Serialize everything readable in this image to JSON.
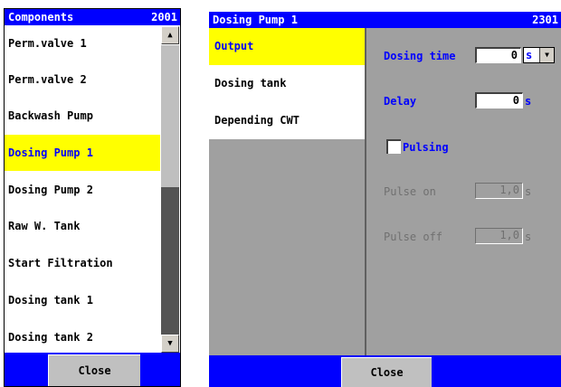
{
  "components": {
    "title": "Components",
    "code": "2001",
    "items": [
      "Perm.valve 1",
      "Perm.valve 2",
      "Backwash Pump",
      "Dosing Pump 1",
      "Dosing Pump 2",
      "Raw W. Tank",
      "Start Filtration",
      "Dosing tank 1",
      "Dosing tank 2"
    ],
    "selected": "Dosing Pump 1",
    "close_label": "Close"
  },
  "detail": {
    "title": "Dosing Pump 1",
    "code": "2301",
    "tabs": [
      "Output",
      "Dosing tank",
      "Depending CWT"
    ],
    "selected_tab": "Output",
    "dosing_time": {
      "label": "Dosing time",
      "value": "0",
      "unit": "s"
    },
    "delay": {
      "label": "Delay",
      "value": "0",
      "unit": "s"
    },
    "pulsing": {
      "label": "Pulsing",
      "checked": false
    },
    "pulse_on": {
      "label": "Pulse on",
      "value": "1,0",
      "unit": "s"
    },
    "pulse_off": {
      "label": "Pulse off",
      "value": "1,0",
      "unit": "s"
    },
    "close_label": "Close"
  },
  "colors": {
    "titlebar": "#0000ff",
    "selection": "#ffff00",
    "panel": "#a0a0a0"
  }
}
